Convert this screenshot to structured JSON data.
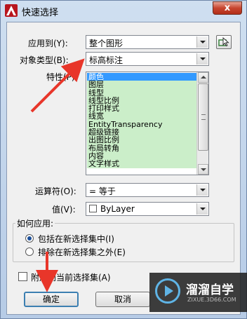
{
  "window": {
    "title": "快速选择",
    "close_label": "x"
  },
  "apply_to": {
    "label": "应用到(Y):",
    "value": "整个图形"
  },
  "object_type": {
    "label": "对象类型(B):",
    "value": "标高标注"
  },
  "properties": {
    "label": "特性(P):",
    "items": [
      "颜色",
      "图层",
      "线型",
      "线型比例",
      "打印样式",
      "线宽",
      "EntityTransparency",
      "超级链接",
      "出图比例",
      "布局转角",
      "内容",
      "文字样式"
    ],
    "selected_index": 0
  },
  "operator": {
    "label": "运算符(O):",
    "value": "= 等于"
  },
  "value_field": {
    "label": "值(V):",
    "value": "ByLayer"
  },
  "how_to_apply": {
    "title": "如何应用:",
    "option_include": "包括在新选择集中(I)",
    "option_exclude": "排除在新选择集之外(E)",
    "selected": "include"
  },
  "append": {
    "label": "附加到当前选择集(A)",
    "checked": false
  },
  "buttons": {
    "ok": "确定",
    "cancel": "取消"
  },
  "watermark": {
    "name": "溜溜自学",
    "url": "ZIXUE.3D66.COM"
  },
  "colors": {
    "annotation_arrow": "#e8362a",
    "list_highlight": "#cbeec9",
    "selection": "#3399ff"
  }
}
